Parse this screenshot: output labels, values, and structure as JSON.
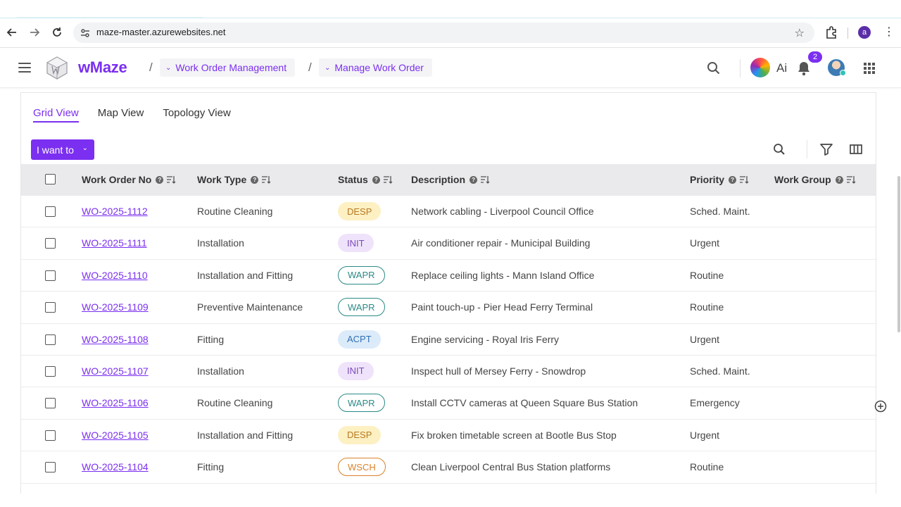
{
  "browser": {
    "url": "maze-master.azurewebsites.net",
    "profile_initial": "a",
    "back_icon": "arrow-left-icon",
    "forward_icon": "arrow-right-icon",
    "reload_icon": "reload-icon",
    "bookmark_icon": "star-icon"
  },
  "header": {
    "brand": "wMaze",
    "breadcrumbs": [
      {
        "label": "Work Order Management"
      },
      {
        "label": "Manage Work Order"
      }
    ],
    "ai_label": "Ai",
    "notification_count": "2"
  },
  "view_tabs": [
    {
      "label": "Grid View",
      "active": true
    },
    {
      "label": "Map View",
      "active": false
    },
    {
      "label": "Topology View",
      "active": false
    }
  ],
  "actions": {
    "i_want_to": "I want to"
  },
  "table": {
    "columns": [
      "Work Order No",
      "Work Type",
      "Status",
      "Description",
      "Priority",
      "Work Group"
    ],
    "rows": [
      {
        "wo": "WO-2025-1112",
        "type": "Routine Cleaning",
        "status": "DESP",
        "desc": "Network cabling - Liverpool Council Office",
        "priority": "Sched. Maint.",
        "group": ""
      },
      {
        "wo": "WO-2025-1111",
        "type": "Installation",
        "status": "INIT",
        "desc": "Air conditioner repair - Municipal Building",
        "priority": "Urgent",
        "group": ""
      },
      {
        "wo": "WO-2025-1110",
        "type": "Installation and Fitting",
        "status": "WAPR",
        "desc": "Replace ceiling lights - Mann Island Office",
        "priority": "Routine",
        "group": ""
      },
      {
        "wo": "WO-2025-1109",
        "type": "Preventive Maintenance",
        "status": "WAPR",
        "desc": "Paint touch-up - Pier Head Ferry Terminal",
        "priority": "Routine",
        "group": ""
      },
      {
        "wo": "WO-2025-1108",
        "type": "Fitting",
        "status": "ACPT",
        "desc": "Engine servicing - Royal Iris Ferry",
        "priority": "Urgent",
        "group": ""
      },
      {
        "wo": "WO-2025-1107",
        "type": "Installation",
        "status": "INIT",
        "desc": "Inspect hull of Mersey Ferry - Snowdrop",
        "priority": "Sched. Maint.",
        "group": ""
      },
      {
        "wo": "WO-2025-1106",
        "type": "Routine Cleaning",
        "status": "WAPR",
        "desc": "Install CCTV cameras at Queen Square Bus Station",
        "priority": "Emergency",
        "group": ""
      },
      {
        "wo": "WO-2025-1105",
        "type": "Installation and Fitting",
        "status": "DESP",
        "desc": "Fix broken timetable screen at Bootle Bus Stop",
        "priority": "Urgent",
        "group": ""
      },
      {
        "wo": "WO-2025-1104",
        "type": "Fitting",
        "status": "WSCH",
        "desc": "Clean Liverpool Central Bus Station platforms",
        "priority": "Routine",
        "group": ""
      }
    ]
  },
  "colors": {
    "accent": "#7b2ff0",
    "status_desp": "#fdf0c3",
    "status_init": "#efe3fb",
    "status_wapr": "#2a8a86",
    "status_acpt": "#dcebfa",
    "status_wsch": "#d9822b"
  }
}
